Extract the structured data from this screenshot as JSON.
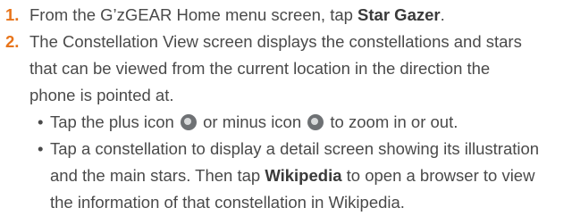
{
  "steps": [
    {
      "num": "1.",
      "pre": "From the G’zGEAR Home menu screen, tap ",
      "bold": "Star Gazer",
      "post": "."
    },
    {
      "num": "2.",
      "lines": [
        "The Constellation View screen displays the constellations and stars",
        "that can be viewed from the current location in the direction the",
        "phone is pointed at."
      ]
    }
  ],
  "bullets": {
    "glyph": "•",
    "zoom": {
      "pre": "Tap the plus icon ",
      "mid": " or minus icon ",
      "post": " to zoom in or out.",
      "plus_icon": "zoom-plus-icon",
      "minus_icon": "zoom-minus-icon"
    },
    "detail": {
      "line1": "Tap a constellation to display a detail screen showing its illustration",
      "line2_pre": "and the main stars. Then tap ",
      "line2_bold": "Wikipedia",
      "line2_post": " to open a browser to view",
      "line3": "the information of that constellation in Wikipedia."
    }
  },
  "colors": {
    "number": "#e8741a",
    "text": "#4a4a4a",
    "icon": "#6e7174"
  }
}
